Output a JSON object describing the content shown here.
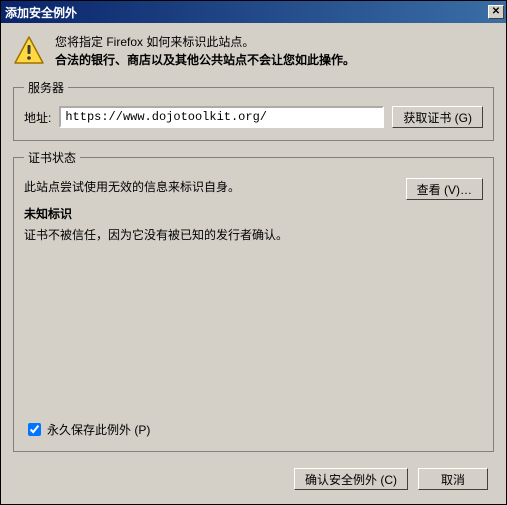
{
  "window": {
    "title": "添加安全例外"
  },
  "header": {
    "line1": "您将指定 Firefox 如何来标识此站点。",
    "line2": "合法的银行、商店以及其他公共站点不会让您如此操作。"
  },
  "server": {
    "legend": "服务器",
    "addr_label": "地址:",
    "addr_value": "https://www.dojotoolkit.org/",
    "get_cert_btn": "获取证书 (G)"
  },
  "status": {
    "legend": "证书状态",
    "line1": "此站点尝试使用无效的信息来标识自身。",
    "view_btn": "查看 (V)…",
    "unknown_heading": "未知标识",
    "unknown_desc": "证书不被信任，因为它没有被已知的发行者确认。"
  },
  "perm": {
    "label": "永久保存此例外 (P)",
    "checked": true
  },
  "footer": {
    "confirm": "确认安全例外 (C)",
    "cancel": "取消"
  }
}
